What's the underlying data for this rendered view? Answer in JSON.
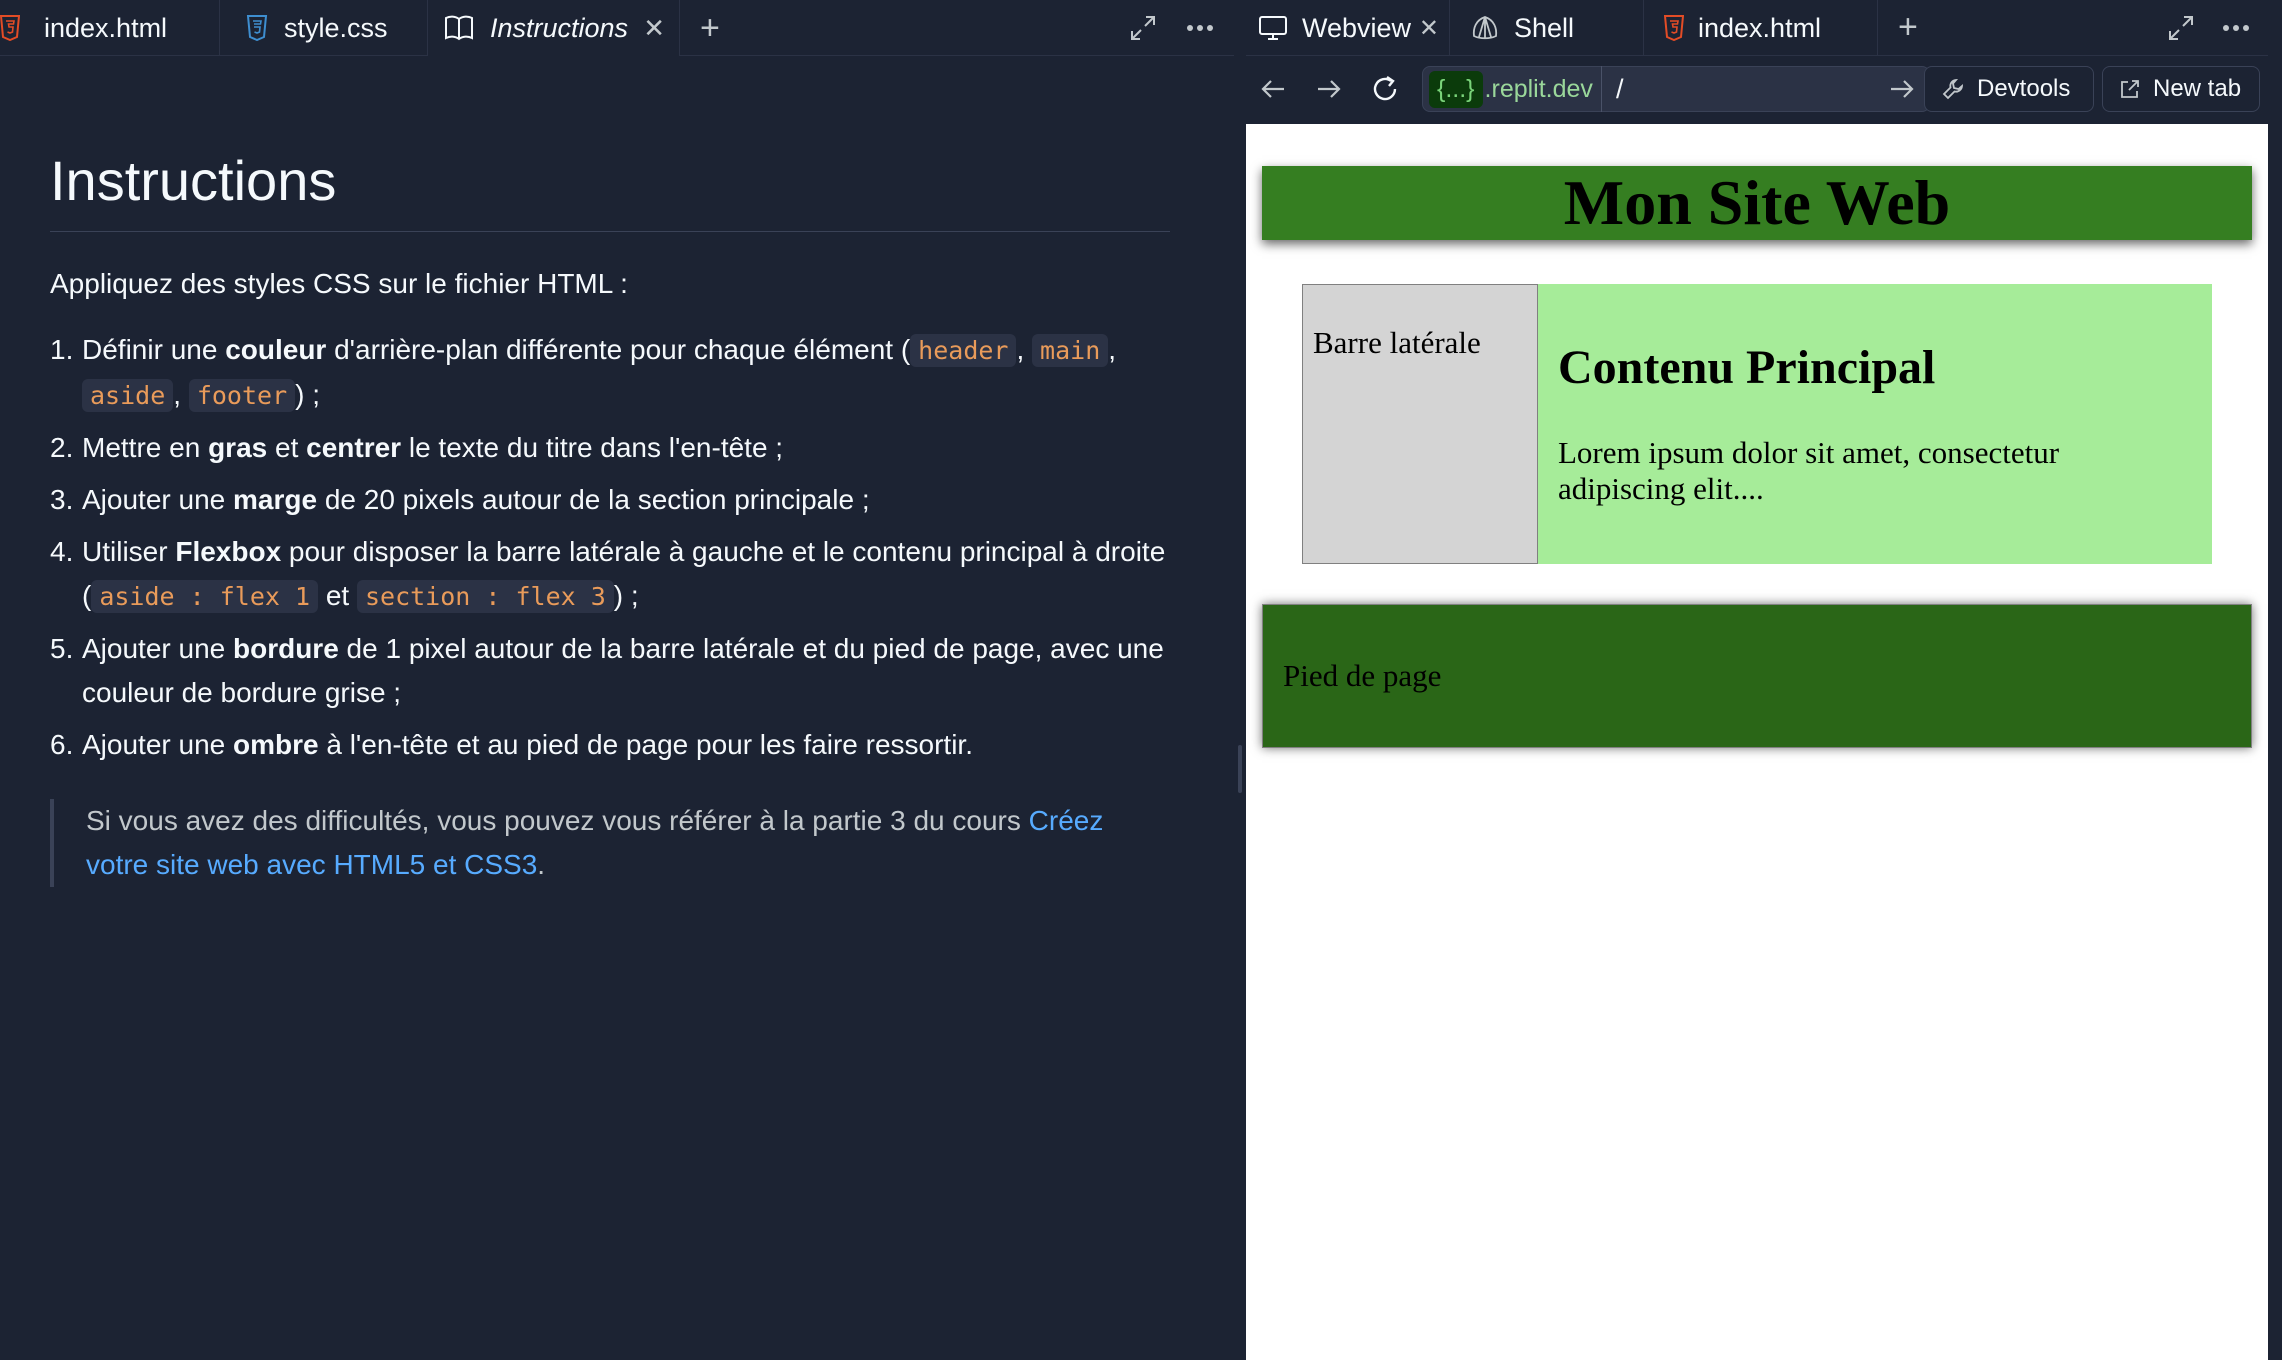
{
  "left_tabs": [
    {
      "label": "index.html",
      "icon": "html5-icon"
    },
    {
      "label": "style.css",
      "icon": "css3-icon"
    },
    {
      "label": "Instructions",
      "icon": "book-icon"
    }
  ],
  "instructions": {
    "title": "Instructions",
    "intro": "Appliquez des styles CSS sur le fichier HTML :",
    "steps": {
      "s1": {
        "num": "1.",
        "a": "Définir une ",
        "b": "couleur",
        "c": " d'arrière-plan différente pour chaque élément (",
        "code1": "header",
        "sep1": ",",
        "code2": "main",
        "sep2": ",",
        "code3": "aside",
        "sep3": ",",
        "code4": "footer",
        "d": ") ;"
      },
      "s2": {
        "num": "2.",
        "a": "Mettre en ",
        "b": "gras",
        "c": " et ",
        "d": "centrer",
        "e": " le texte du titre dans l'en-tête ;"
      },
      "s3": {
        "num": "3.",
        "a": "Ajouter une ",
        "b": "marge",
        "c": " de 20 pixels autour de la section principale ;"
      },
      "s4": {
        "num": "4.",
        "a": "Utiliser ",
        "b": "Flexbox",
        "c": " pour disposer la barre latérale à gauche et le contenu principal à droite (",
        "code1": "aside : flex 1",
        "d": " et ",
        "code2": "section : flex 3",
        "e": ") ;"
      },
      "s5": {
        "num": "5.",
        "a": "Ajouter une ",
        "b": "bordure",
        "c": " de 1 pixel autour de la barre latérale et du pied de page, avec une couleur de bordure grise ;"
      },
      "s6": {
        "num": "6.",
        "a": "Ajouter une ",
        "b": "ombre",
        "c": " à l'en-tête et au pied de page pour les faire ressortir."
      }
    },
    "note": {
      "text": "Si vous avez des difficultés, vous pouvez vous référer à la partie 3 du cours ",
      "link": "Créez votre site web avec HTML5 et CSS3",
      "end": "."
    }
  },
  "right_tabs": [
    {
      "label": "Webview",
      "icon": "monitor-icon"
    },
    {
      "label": "Shell",
      "icon": "shell-icon"
    },
    {
      "label": "index.html",
      "icon": "html5-icon"
    }
  ],
  "browser": {
    "host_badge": "{...}",
    "domain": ".replit.dev",
    "path": "/",
    "devtools_label": "Devtools",
    "newtab_label": "New tab"
  },
  "site": {
    "header": "Mon Site Web",
    "aside": "Barre latérale",
    "section_title": "Contenu Principal",
    "section_text": "Lorem ipsum dolor sit amet, consectetur adipiscing elit....",
    "footer": "Pied de page"
  },
  "colors": {
    "editor_bg": "#1c2333",
    "code_orange": "#e99b5a",
    "link_blue": "#57abff",
    "site_header_green": "#357e21",
    "site_section_green": "#a6ec99",
    "site_aside_gray": "#d4d4d4",
    "site_footer_green": "#2a6617"
  }
}
